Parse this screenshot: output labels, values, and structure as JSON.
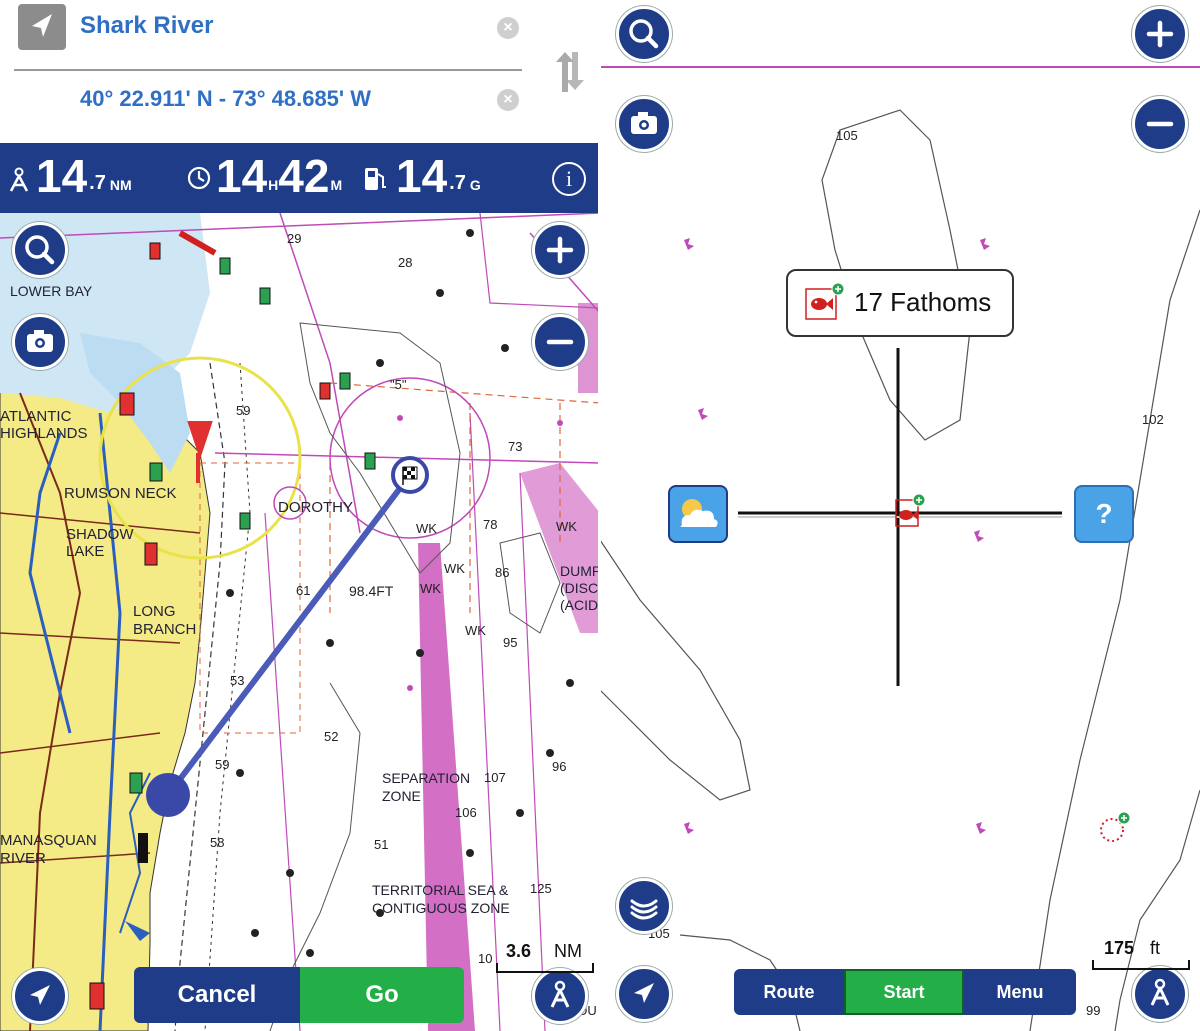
{
  "route": {
    "from": "Shark River",
    "to": "40° 22.911' N - 73° 48.685' W",
    "clear_glyph": "×"
  },
  "info_bar": {
    "distance_int": "14",
    "distance_frac": ".7",
    "distance_unit": "NM",
    "time_h": "14",
    "time_h_unit": "H",
    "time_m": "42",
    "time_m_unit": "M",
    "fuel_int": "14",
    "fuel_frac": ".7",
    "fuel_unit": "G",
    "info_glyph": "i"
  },
  "left_map": {
    "place_labels": [
      "ATLANTIC",
      "HIGHLANDS",
      "RUMSON NECK",
      "SHADOW",
      "LAKE",
      "LONG",
      "BRANCH",
      "MANASQUAN",
      "RIVER",
      "DOROTHY",
      "SEPARATION",
      "ZONE",
      "TERRITORIAL SEA &",
      "CONTIGUOUS ZONE",
      "LOWER BAY",
      "DUMP",
      "(DISC",
      "(ACID"
    ],
    "depth_labels": [
      "29",
      "28",
      "59",
      "73",
      "78",
      "86",
      "95",
      "96",
      "106",
      "107",
      "98.4FT",
      "61",
      "53",
      "52",
      "58",
      "51",
      "59",
      "\"5\"",
      "WK",
      "WK",
      "WK",
      "WK",
      "WK",
      "125",
      "10",
      "DU"
    ],
    "scale_value": "3.6",
    "scale_unit": "NM"
  },
  "actions": {
    "cancel": "Cancel",
    "go": "Go"
  },
  "right_map": {
    "callout_label": "17 Fathoms",
    "help_glyph": "?",
    "depth_labels": [
      "105",
      "102",
      "105",
      "99"
    ],
    "scale_value": "175",
    "scale_unit": "ft"
  },
  "bottom_bar": {
    "route": "Route",
    "start": "Start",
    "menu": "Menu"
  },
  "colors": {
    "navy": "#1f3c88",
    "green": "#23ae48",
    "link_blue": "#2f6fc4",
    "land_yellow": "#f6ec84",
    "magenta": "#c04ab8",
    "route_line": "#4a5bb8"
  },
  "icons": [
    "navigate-arrow-icon",
    "clear-icon",
    "swap-icon",
    "compass-person-icon",
    "clock-icon",
    "fuel-icon",
    "info-icon",
    "search-icon",
    "camera-icon",
    "zoom-in-icon",
    "zoom-out-icon",
    "locate-icon",
    "checkered-flag-icon",
    "weather-icon",
    "help-icon",
    "fish-icon",
    "sonar-icon"
  ]
}
